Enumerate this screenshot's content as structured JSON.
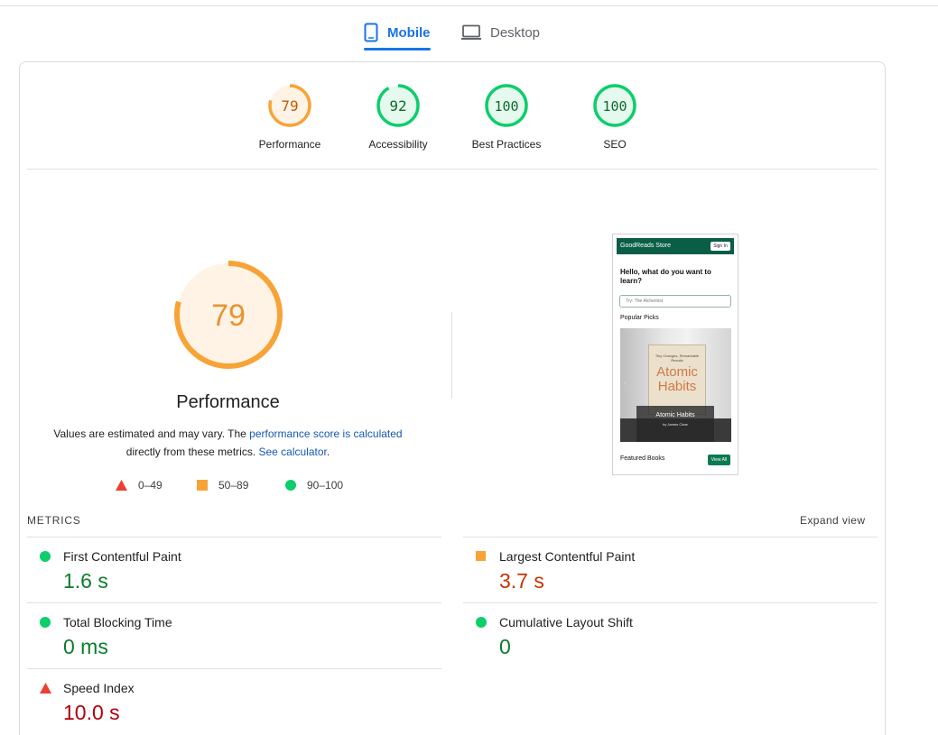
{
  "tabs": {
    "mobile": "Mobile",
    "desktop": "Desktop"
  },
  "gauges": [
    {
      "score": "79",
      "label": "Performance",
      "color": "#f7a336",
      "fraction": 0.79
    },
    {
      "score": "92",
      "label": "Accessibility",
      "color": "#0cce6b",
      "fraction": 0.92
    },
    {
      "score": "100",
      "label": "Best Practices",
      "color": "#0cce6b",
      "fraction": 1.0
    },
    {
      "score": "100",
      "label": "SEO",
      "color": "#0cce6b",
      "fraction": 1.0
    }
  ],
  "performance": {
    "score": "79",
    "fraction": 0.79,
    "title": "Performance",
    "desc_prefix": "Values are estimated and may vary. The ",
    "desc_link1": "performance score is calculated",
    "desc_middle": " directly from these metrics. ",
    "desc_link2": "See calculator",
    "desc_suffix": "."
  },
  "legend": [
    {
      "range": "0–49",
      "shape": "triangle",
      "color": "#ff4e42"
    },
    {
      "range": "50–89",
      "shape": "square",
      "color": "#ffa400"
    },
    {
      "range": "90–100",
      "shape": "circle",
      "color": "#0cce6b"
    }
  ],
  "screenshot": {
    "brand": "GoodReads Store",
    "signin": "Sign In",
    "hello": "Hello, what do you want to learn?",
    "search_placeholder": "Try: The Alchemist",
    "popular": "Popular Picks",
    "book_small": "Tiny Changes, Remarkable Results",
    "book_title": "Atomic Habits",
    "caption_title": "Atomic Habits",
    "caption_sub": "by James Clear",
    "featured": "Featured Books",
    "view_all": "View All"
  },
  "metrics": {
    "label": "METRICS",
    "expand": "Expand view",
    "items": [
      {
        "name": "First Contentful Paint",
        "value": "1.6 s",
        "status": "good"
      },
      {
        "name": "Largest Contentful Paint",
        "value": "3.7 s",
        "status": "average"
      },
      {
        "name": "Total Blocking Time",
        "value": "0 ms",
        "status": "good"
      },
      {
        "name": "Cumulative Layout Shift",
        "value": "0",
        "status": "good"
      },
      {
        "name": "Speed Index",
        "value": "10.0 s",
        "status": "poor"
      }
    ]
  }
}
